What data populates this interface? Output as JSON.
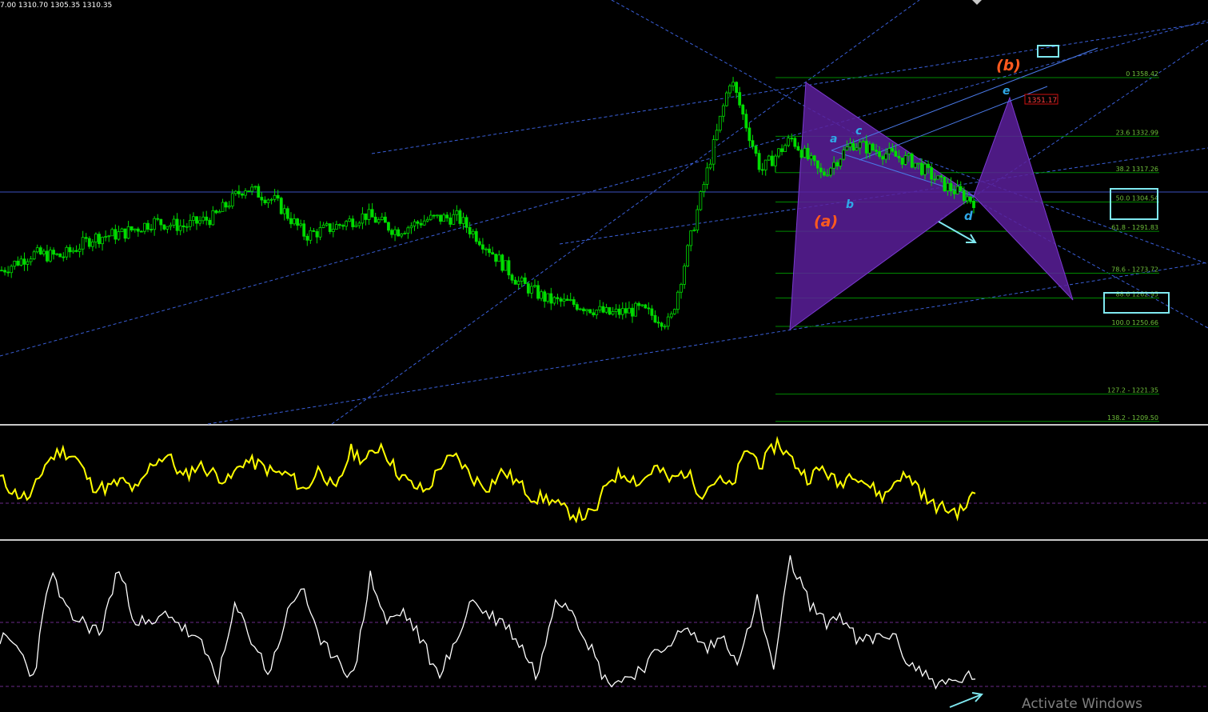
{
  "header": {
    "ohlc_text": "7.00 1310.70 1305.35 1310.35"
  },
  "watermark": {
    "text": "Activate Windows"
  },
  "colors": {
    "background": "#000000",
    "candles": "#00dc00",
    "fib_lines": "#008a00",
    "fib_text": "#6fbf3a",
    "trend_lines": "#3a5fd8",
    "harmonic_fill": "#5a1e9a",
    "wave_labels_minor": "#2fa8e8",
    "wave_labels_major": "#ff5a1e",
    "highlight_box": "#7fe8f0",
    "price_tag": "#d01010",
    "oscillator_1": "#ffff00",
    "oscillator_2": "#ffffff",
    "osc_levels": "#6a2a8a",
    "arrows": "#7fe8f0"
  },
  "chart_data": [
    {
      "type": "candlestick",
      "panel": "price",
      "title": "",
      "series": [
        {
          "values": [
            1275.0,
            1282.0,
            1281.0,
            1289.0,
            1291.0,
            1296.0,
            1294.0,
            1298.0,
            1311.0,
            1305.0,
            1290.0,
            1294.0,
            1299.0,
            1292.0,
            1297.0,
            1298.0,
            1285.0,
            1270.0,
            1262.0,
            1260.0,
            1256.0,
            1258.0,
            1252.0,
            1306.0,
            1358.4,
            1318.0,
            1332.0,
            1316.0,
            1330.0,
            1326.0,
            1322.0,
            1312.0,
            1305.0
          ]
        }
      ],
      "fibonacci_levels": [
        {
          "label": "0 1358.42",
          "value": 1358.42
        },
        {
          "label": "23.6 1332.99",
          "value": 1332.99
        },
        {
          "label": "38.2 1317.26",
          "value": 1317.26
        },
        {
          "label": "50.0 1304.54",
          "value": 1304.54
        },
        {
          "label": "61.8 - 1291.83",
          "value": 1291.83
        },
        {
          "label": "78.6 - 1273.72",
          "value": 1273.72
        },
        {
          "label": "88.6 1262.95",
          "value": 1262.95
        },
        {
          "label": "100.0 1250.66",
          "value": 1250.66
        },
        {
          "label": "127.2 - 1221.35",
          "value": 1221.35
        },
        {
          "label": "138.2 - 1209.50",
          "value": 1209.5
        }
      ],
      "price_tag": "1351.17",
      "wave_labels": [
        "(a)",
        "(b)",
        "a",
        "b",
        "c",
        "d",
        "e"
      ]
    },
    {
      "type": "line",
      "panel": "oscillator-1",
      "series": [
        {
          "values": [
            55,
            40,
            35,
            70,
            82,
            75,
            48,
            45,
            52,
            42,
            70,
            78,
            55,
            68,
            60,
            52,
            72,
            68,
            60,
            58,
            42,
            66,
            40,
            82,
            72,
            88,
            62,
            48,
            42,
            70,
            75,
            55,
            46,
            62,
            50,
            36,
            35,
            24,
            18,
            20,
            55,
            60,
            50,
            66,
            52,
            62,
            40,
            54,
            45,
            84,
            68,
            90,
            72,
            55,
            65,
            48,
            62,
            48,
            36,
            58,
            52,
            30,
            25,
            22,
            40
          ]
        }
      ],
      "levels": [
        "upper",
        "lower"
      ]
    },
    {
      "type": "line",
      "panel": "oscillator-2",
      "series": [
        {
          "values": [
            45,
            40,
            20,
            88,
            60,
            55,
            48,
            90,
            58,
            52,
            62,
            50,
            40,
            20,
            65,
            44,
            22,
            58,
            80,
            40,
            35,
            18,
            85,
            55,
            62,
            45,
            22,
            38,
            70,
            60,
            55,
            40,
            20,
            72,
            65,
            42,
            18,
            18,
            25,
            34,
            45,
            50,
            38,
            46,
            30,
            70,
            25,
            95,
            70,
            55,
            60,
            42,
            45,
            48,
            30,
            22,
            15,
            18,
            22
          ]
        }
      ],
      "levels": [
        "upper",
        "lower"
      ]
    }
  ]
}
